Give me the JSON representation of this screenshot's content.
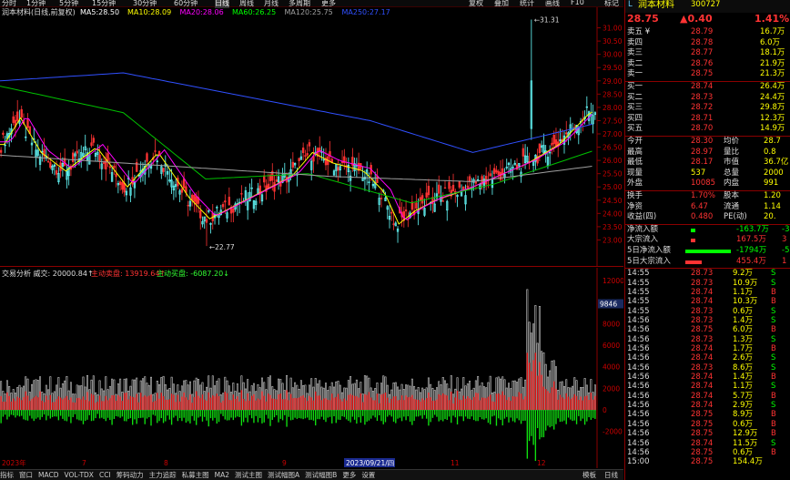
{
  "top_tabs": [
    "分时",
    "1分钟",
    "5分钟",
    "15分钟",
    "30分钟",
    "60分钟",
    "日线",
    "周线",
    "月线",
    "多周期",
    "更多"
  ],
  "top_right_tabs": [
    "复权",
    "叠加",
    "统计",
    "画线",
    "F10",
    "标记"
  ],
  "chart_title": "润本材料(日线,前复权)",
  "ma": [
    {
      "label": "MA5:",
      "value": "28.50",
      "color": "#ffffff"
    },
    {
      "label": "MA10:",
      "value": "28.09",
      "color": "#ffff00"
    },
    {
      "label": "MA20:",
      "value": "28.06",
      "color": "#ff00ff"
    },
    {
      "label": "MA60:",
      "value": "26.25",
      "color": "#00ff00"
    },
    {
      "label": "MA120:",
      "value": "25.75",
      "color": "#a0a0a0"
    },
    {
      "label": "MA250:",
      "value": "27.17",
      "color": "#3050ff"
    }
  ],
  "price_axis": [
    "31.00",
    "30.50",
    "30.00",
    "29.50",
    "29.00",
    "28.50",
    "28.00",
    "27.50",
    "27.00",
    "26.50",
    "26.00",
    "25.50",
    "25.00",
    "24.50",
    "24.00",
    "23.50",
    "23.00"
  ],
  "max_label": "31.31",
  "min_label": "22.77",
  "vol_header": {
    "title": "交易分析 威交: 20000.84↑",
    "main_sell": "主动卖盘: 13919.64↑",
    "main_buy": "主动买盘: -6087.20↓"
  },
  "vol_axis": [
    "12000",
    "10000",
    "8000",
    "6000",
    "4000",
    "2000",
    "0",
    "-2000"
  ],
  "vol_marker": "9846",
  "month_labels": [
    "7",
    "8",
    "9",
    "11",
    "12"
  ],
  "date_box": "2023/09/21/四",
  "year_label": "2023年",
  "bottom_tabs": [
    "指标",
    "窗口",
    "MACD",
    "VOL-TDX",
    "CCI",
    "筹码动力",
    "主力追踪",
    "私募主图",
    "MA2",
    "测试主图",
    "测试幅图A",
    "测试幅图B",
    "更多",
    "设置"
  ],
  "bottom_right": [
    "模板",
    "日线"
  ],
  "stock": {
    "name": "润本材料",
    "code": "300727",
    "price": "28.75",
    "change": "▲0.40",
    "pct": "1.41%"
  },
  "asks": [
    {
      "l": "卖五",
      "flag": "¥",
      "p": "28.79",
      "v": "16.7万"
    },
    {
      "l": "卖四",
      "flag": "",
      "p": "28.78",
      "v": "6.0万"
    },
    {
      "l": "卖三",
      "flag": "",
      "p": "28.77",
      "v": "18.1万"
    },
    {
      "l": "卖二",
      "flag": "",
      "p": "28.76",
      "v": "21.9万"
    },
    {
      "l": "卖一",
      "flag": "",
      "p": "28.75",
      "v": "21.3万"
    }
  ],
  "bids": [
    {
      "l": "买一",
      "p": "28.74",
      "v": "26.4万"
    },
    {
      "l": "买二",
      "p": "28.73",
      "v": "24.4万"
    },
    {
      "l": "买三",
      "p": "28.72",
      "v": "29.8万"
    },
    {
      "l": "买四",
      "p": "28.71",
      "v": "12.3万"
    },
    {
      "l": "买五",
      "p": "28.70",
      "v": "14.9万"
    }
  ],
  "stats": [
    {
      "a": "今开",
      "av": "28.30",
      "b": "均价",
      "bv": "28.7"
    },
    {
      "a": "最高",
      "av": "28.97",
      "b": "量比",
      "bv": "0.8"
    },
    {
      "a": "最低",
      "av": "28.17",
      "b": "市值",
      "bv": "36.7亿"
    },
    {
      "a": "现量",
      "av": "537",
      "b": "总量",
      "bv": "2000"
    },
    {
      "a": "外盘",
      "av": "10085",
      "b": "内盘",
      "bv": "991"
    },
    {
      "a": "换手",
      "av": "1.70%",
      "b": "股本",
      "bv": "1.20"
    },
    {
      "a": "净资",
      "av": "6.47",
      "b": "流通",
      "bv": "1.14"
    },
    {
      "a": "收益(四)",
      "av": "0.480",
      "b": "PE(动)",
      "bv": "20."
    }
  ],
  "flows": [
    {
      "l": "净流入额",
      "v": "-163.7万",
      "x": "-3"
    },
    {
      "l": "大宗流入",
      "v": "167.5万",
      "x": "3"
    },
    {
      "l": "5日净流入额",
      "v": "-1794万",
      "x": "-5"
    },
    {
      "l": "5日大宗流入",
      "v": "455.4万",
      "x": "1"
    }
  ],
  "ticks": [
    {
      "t": "14:55",
      "p": "28.73",
      "v": "9.2万",
      "d": "S"
    },
    {
      "t": "14:55",
      "p": "28.73",
      "v": "10.9万",
      "d": "S"
    },
    {
      "t": "14:55",
      "p": "28.74",
      "v": "1.1万",
      "d": "B"
    },
    {
      "t": "14:55",
      "p": "28.74",
      "v": "10.3万",
      "d": "B"
    },
    {
      "t": "14:55",
      "p": "28.73",
      "v": "0.6万",
      "d": "S"
    },
    {
      "t": "14:56",
      "p": "28.73",
      "v": "1.4万",
      "d": "S"
    },
    {
      "t": "14:56",
      "p": "28.75",
      "v": "6.0万",
      "d": "B"
    },
    {
      "t": "14:56",
      "p": "28.73",
      "v": "1.3万",
      "d": "S"
    },
    {
      "t": "14:56",
      "p": "28.74",
      "v": "1.7万",
      "d": "B"
    },
    {
      "t": "14:56",
      "p": "28.74",
      "v": "2.6万",
      "d": "S"
    },
    {
      "t": "14:56",
      "p": "28.73",
      "v": "8.6万",
      "d": "S"
    },
    {
      "t": "14:56",
      "p": "28.74",
      "v": "1.4万",
      "d": "B"
    },
    {
      "t": "14:56",
      "p": "28.74",
      "v": "1.1万",
      "d": "S"
    },
    {
      "t": "14:56",
      "p": "28.74",
      "v": "5.7万",
      "d": "B"
    },
    {
      "t": "14:56",
      "p": "28.74",
      "v": "2.9万",
      "d": "S"
    },
    {
      "t": "14:56",
      "p": "28.75",
      "v": "8.9万",
      "d": "B"
    },
    {
      "t": "14:56",
      "p": "28.75",
      "v": "0.6万",
      "d": "B"
    },
    {
      "t": "14:56",
      "p": "28.75",
      "v": "12.9万",
      "d": "B"
    },
    {
      "t": "14:56",
      "p": "28.74",
      "v": "11.5万",
      "d": "S"
    },
    {
      "t": "14:56",
      "p": "28.75",
      "v": "0.6万",
      "d": "B"
    },
    {
      "t": "15:00",
      "p": "28.75",
      "v": "154.4万",
      "d": ""
    }
  ]
}
